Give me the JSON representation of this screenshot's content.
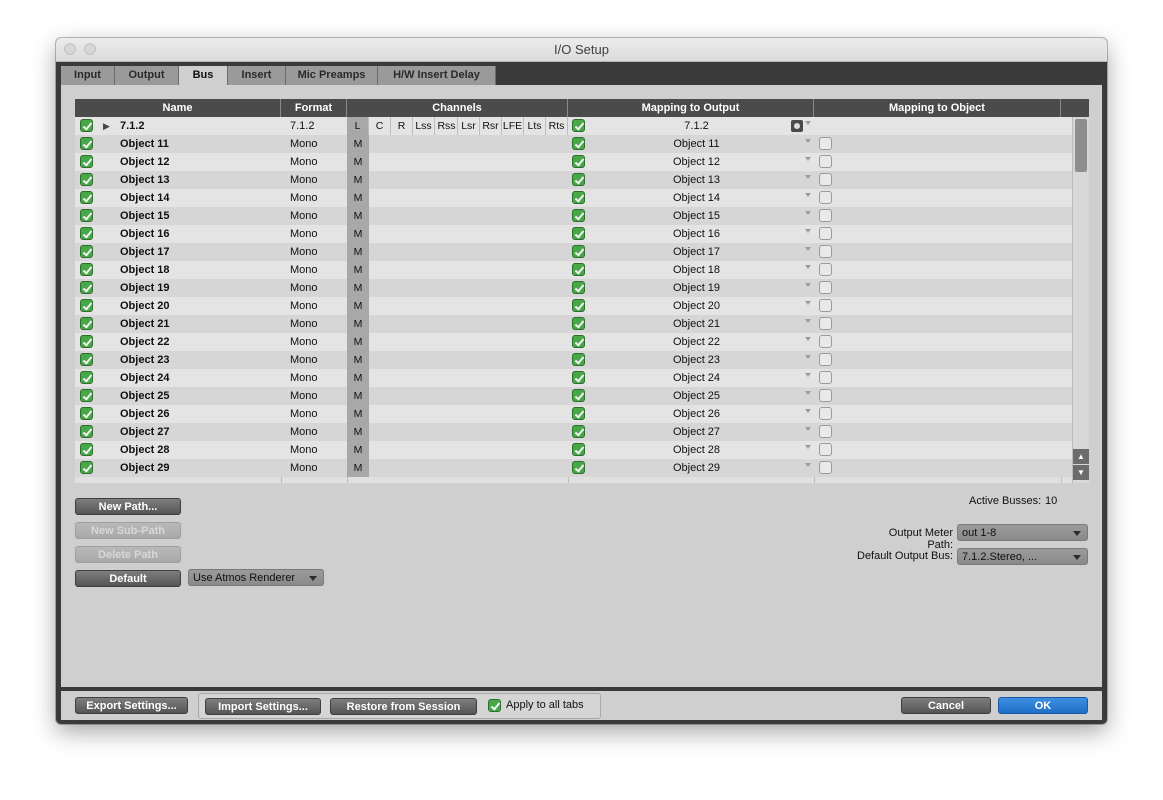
{
  "window": {
    "title": "I/O Setup"
  },
  "tabs": [
    {
      "label": "Input",
      "active": false
    },
    {
      "label": "Output",
      "active": false
    },
    {
      "label": "Bus",
      "active": true
    },
    {
      "label": "Insert",
      "active": false
    },
    {
      "label": "Mic Preamps",
      "active": false
    },
    {
      "label": "H/W Insert Delay",
      "active": false
    }
  ],
  "table": {
    "headers": {
      "name": "Name",
      "format": "Format",
      "channels": "Channels",
      "mapping_output": "Mapping to Output",
      "mapping_object": "Mapping to Object"
    },
    "channel_labels": [
      "L",
      "C",
      "R",
      "Lss",
      "Rss",
      "Lsr",
      "Rsr",
      "LFE",
      "Lts",
      "Rts"
    ],
    "parent_row": {
      "name": "7.1.2",
      "format": "7.1.2",
      "mapping": "7.1.2",
      "expand_icon": "triangle-right-icon",
      "speaker_icon": "speaker-icon"
    },
    "rows": [
      {
        "name": "Object 11",
        "format": "Mono",
        "channel": "M",
        "mapping": "Object 11"
      },
      {
        "name": "Object 12",
        "format": "Mono",
        "channel": "M",
        "mapping": "Object 12"
      },
      {
        "name": "Object 13",
        "format": "Mono",
        "channel": "M",
        "mapping": "Object 13"
      },
      {
        "name": "Object 14",
        "format": "Mono",
        "channel": "M",
        "mapping": "Object 14"
      },
      {
        "name": "Object 15",
        "format": "Mono",
        "channel": "M",
        "mapping": "Object 15"
      },
      {
        "name": "Object 16",
        "format": "Mono",
        "channel": "M",
        "mapping": "Object 16"
      },
      {
        "name": "Object 17",
        "format": "Mono",
        "channel": "M",
        "mapping": "Object 17"
      },
      {
        "name": "Object 18",
        "format": "Mono",
        "channel": "M",
        "mapping": "Object 18"
      },
      {
        "name": "Object 19",
        "format": "Mono",
        "channel": "M",
        "mapping": "Object 19"
      },
      {
        "name": "Object 20",
        "format": "Mono",
        "channel": "M",
        "mapping": "Object 20"
      },
      {
        "name": "Object 21",
        "format": "Mono",
        "channel": "M",
        "mapping": "Object 21"
      },
      {
        "name": "Object 22",
        "format": "Mono",
        "channel": "M",
        "mapping": "Object 22"
      },
      {
        "name": "Object 23",
        "format": "Mono",
        "channel": "M",
        "mapping": "Object 23"
      },
      {
        "name": "Object 24",
        "format": "Mono",
        "channel": "M",
        "mapping": "Object 24"
      },
      {
        "name": "Object 25",
        "format": "Mono",
        "channel": "M",
        "mapping": "Object 25"
      },
      {
        "name": "Object 26",
        "format": "Mono",
        "channel": "M",
        "mapping": "Object 26"
      },
      {
        "name": "Object 27",
        "format": "Mono",
        "channel": "M",
        "mapping": "Object 27"
      },
      {
        "name": "Object 28",
        "format": "Mono",
        "channel": "M",
        "mapping": "Object 28"
      },
      {
        "name": "Object 29",
        "format": "Mono",
        "channel": "M",
        "mapping": "Object 29"
      }
    ]
  },
  "path_buttons": {
    "new_path": "New Path...",
    "new_sub_path": "New Sub-Path",
    "delete_path": "Delete Path",
    "default": "Default"
  },
  "renderer_select": {
    "value": "Use Atmos Renderer"
  },
  "active_busses": {
    "label": "Active Busses:",
    "value": "10"
  },
  "output_meter_path": {
    "label": "Output Meter Path:",
    "value": "out 1-8"
  },
  "default_output_bus": {
    "label": "Default Output Bus:",
    "value": "7.1.2.Stereo, ..."
  },
  "bottom": {
    "export": "Export Settings...",
    "import": "Import Settings...",
    "restore": "Restore from Session",
    "apply_all": "Apply to all tabs",
    "cancel": "Cancel",
    "ok": "OK"
  },
  "colors": {
    "checkbox_on": "#46a846",
    "ok_button": "#1f6fc8",
    "header_bg": "#4b4b4b"
  }
}
